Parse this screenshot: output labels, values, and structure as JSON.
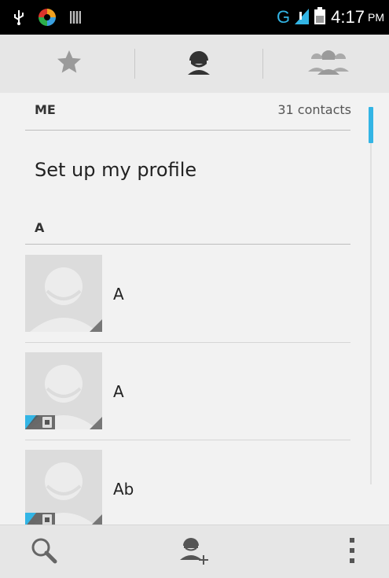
{
  "status_bar": {
    "time": "4:17",
    "ampm": "PM",
    "network": "G"
  },
  "tabs": [
    {
      "name": "favorites",
      "icon": "star-icon"
    },
    {
      "name": "contacts",
      "icon": "person-icon",
      "selected": true
    },
    {
      "name": "groups",
      "icon": "group-icon"
    }
  ],
  "list": {
    "me_header": "ME",
    "contact_count": "31 contacts",
    "profile_text": "Set up my profile",
    "section_letter": "A",
    "contacts": [
      {
        "name": "A",
        "sim_badge": false
      },
      {
        "name": "A",
        "sim_badge": true
      },
      {
        "name": "Ab",
        "sim_badge": true
      }
    ]
  },
  "bottom_bar": {
    "search_icon": "search-icon",
    "add_contact_icon": "add-contact-icon",
    "menu_icon": "overflow-menu-icon"
  },
  "colors": {
    "accent": "#33b5e5",
    "status_bar_bg": "#000000",
    "tab_bg": "#e6e6e6"
  }
}
